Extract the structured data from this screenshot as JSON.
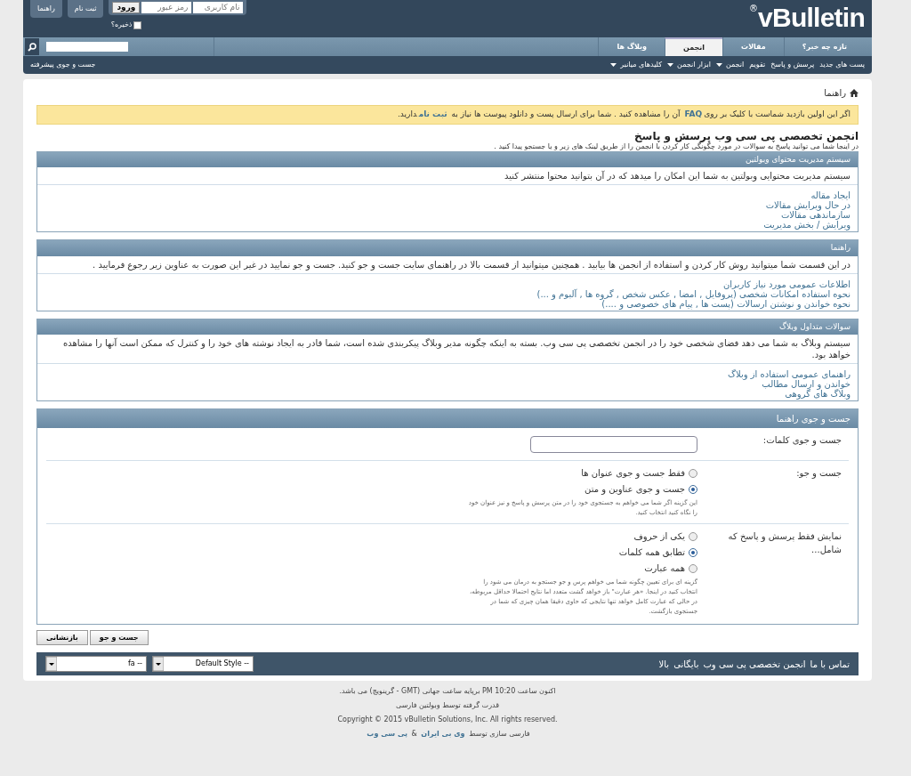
{
  "logo": {
    "text": "vBulletin",
    "mark": "®"
  },
  "login": {
    "username_placeholder": "نام کاربری",
    "password_placeholder": "رمز عبور",
    "submit": "ورود",
    "remember": {
      "label": "ذخیره؟",
      "checked": false
    },
    "buttons": [
      "ثبت نام",
      "راهنما"
    ]
  },
  "tabs": [
    {
      "label": "تازه چه خبر؟",
      "selected": false
    },
    {
      "label": "مقالات",
      "selected": false
    },
    {
      "label": "انجمن",
      "selected": true
    },
    {
      "label": "وبلاگ ها",
      "selected": false
    }
  ],
  "subnav": {
    "items": [
      {
        "label": "پست های جدید",
        "dropdown": false
      },
      {
        "label": "پرسش و پاسخ",
        "dropdown": false
      },
      {
        "label": "تقویم",
        "dropdown": false
      },
      {
        "label": "انجمن",
        "dropdown": true
      },
      {
        "label": "ابزار انجمن",
        "dropdown": true
      },
      {
        "label": "کلیدهای میانبر",
        "dropdown": true
      }
    ],
    "advanced_search": "جست و جوی پیشرفته"
  },
  "breadcrumb": "راهنما",
  "notice": [
    {
      "kind": "text",
      "text": "اگر این اولین بازدید شماست با کلیک بر روی"
    },
    {
      "kind": "link",
      "text": "FAQ"
    },
    {
      "kind": "text",
      "text": " آن را مشاهده کنید . شما برای ارسال پست و دانلود پیوست ها نیاز به "
    },
    {
      "kind": "link",
      "text": "ثبت نام"
    },
    {
      "kind": "text",
      "text": "دارید."
    }
  ],
  "page_title": "انجمن تخصصی پی سی وب پرسش و پاسخ",
  "page_subtitle": "در اینجا شما می توانید پاسخ به سوالات در مورد چگونگی کار کردن با انجمن را از طریق لینک های زیر و یا جستجو پیدا کنید .",
  "blocks": [
    {
      "title": "سیستم مدیریت محتوای وبولتین",
      "description": "سیستم مدیریت محتوایی وبولتین به شما این امکان را میدهد که در آن بتوانید محتوا منتشر کنید",
      "links": [
        "ایجاد مقاله",
        "در حال ویرایش مقالات",
        "سازماندهی مقالات",
        "ویرایش / بخش مدیریت"
      ]
    },
    {
      "title": "راهنما",
      "description": "در این قسمت شما میتوانید روش کار کردن و استفاده از انجمن ها بیابید . همچنین میتوانید از قسمت بالا در راهنمای سایت جست و جو کنید. جست و جو نمایید در غیر این صورت به عناوین زیر رجوع فرمایید .",
      "links": [
        "اطلاعات عمومی مورد نیاز کاربران",
        "نحوه استفاده امکانات شخصی (پروفایل , امضا , عکس شخص , گروه ها , آلبوم و ...)",
        "نحوه خواندن و نوشتن ارسالات (پست ها , پیام های خصوصی و ....)"
      ]
    },
    {
      "title": "سوالات متداول وبلاگ",
      "description": "سیستم وبلاگ به شما می دهد فضای شخصی خود را در انجمن تخصصی پی سی وب. بسته به اینکه چگونه مدیر وبلاگ پیکربندی شده است، شما قادر به ایجاد نوشته های خود را و کنترل که ممکن است آنها را مشاهده خواهد بود.",
      "links": [
        "راهنمای عمومی استفاده از وبلاگ",
        "خواندن و ارسال مطالب",
        "وبلاگ های گروهی"
      ]
    }
  ],
  "search_form": {
    "title": "جست و جوی راهنما",
    "rows": [
      {
        "kind": "text",
        "label": "جست و جوی کلمات:"
      },
      {
        "kind": "radio",
        "label": "جست و جو:",
        "options": [
          {
            "label": "فقط جست و جوی عنوان ها",
            "selected": false
          },
          {
            "label": "جست و جوی عناوین و متن",
            "selected": true
          }
        ],
        "hint": "این گزینه اگر شما می خواهم به جستجوی خود را در متن پرسش و پاسخ و نیز عنوان خود را نگاه کنید انتخاب کنید."
      },
      {
        "kind": "radio",
        "label": "نمایش فقط پرسش و پاسخ که شامل...",
        "options": [
          {
            "label": "یکی از حروف",
            "selected": false
          },
          {
            "label": "تطابق همه کلمات",
            "selected": true
          },
          {
            "label": "همه عبارت",
            "selected": false
          }
        ],
        "hint": "گزینه ای برای تعیین چگونه شما می خواهم پرس و جو جستجو به درمان می شود را انتخاب کنید در اینجا. «هر عبارت\" باز خواهد گشت متعدد اما نتایج احتمالا حداقل مربوطه، در حالی که عبارت کامل خواهد تنها نتایجی که حاوی دقیقا همان چیزی که شما در جستجوی بازگشت."
      }
    ],
    "buttons": [
      "جست و جو",
      "بازنشانی"
    ]
  },
  "footer_bar": {
    "links": [
      "تماس با ما",
      "انجمن تخصصی پی سی وب",
      "بایگانی",
      "بالا"
    ],
    "selects": [
      "-- Default Style",
      "-- fa"
    ]
  },
  "footer": {
    "time": "اکنون ساعت 10:20 PM برپایه ساعت جهانی (GMT - گرینویچ) می باشد.",
    "powered": "قدرت گرفته توسط وبولتین فارسی",
    "copyright": "Copyright © 2015 vBulletin Solutions, Inc. All rights reserved.",
    "credit": [
      {
        "kind": "text",
        "text": "فارسی سازی توسط "
      },
      {
        "kind": "link",
        "text": "وی بی ایران"
      },
      {
        "kind": "text",
        "text": " & "
      },
      {
        "kind": "link",
        "text": "پی سی وب"
      }
    ]
  }
}
